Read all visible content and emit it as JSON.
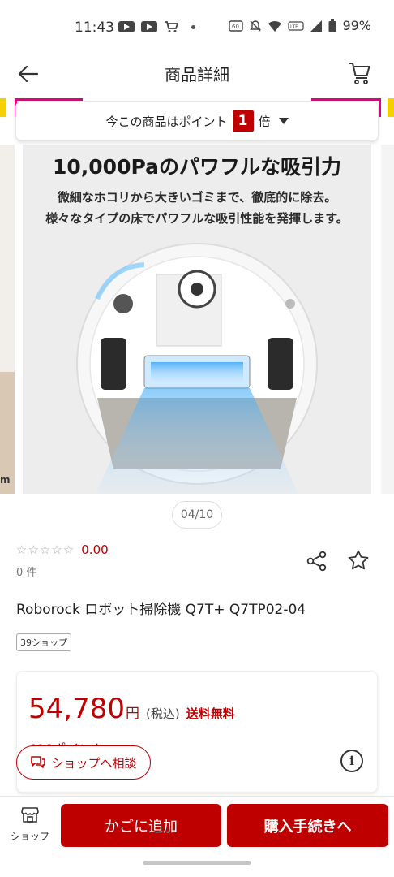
{
  "status_bar": {
    "time": "11:43",
    "battery": "99%",
    "icons": [
      "youtube-icon",
      "youtube-icon",
      "cart-notification-icon",
      "dot-icon",
      "data-saver-icon",
      "mute-icon",
      "wifi-icon",
      "volte-icon",
      "signal-icon",
      "battery-icon"
    ]
  },
  "header": {
    "title": "商品詳細",
    "back_icon": "back-arrow-icon",
    "cart_icon": "cart-icon"
  },
  "point_banner": {
    "text": "今この商品はポイント",
    "multiplier": "1",
    "suffix": "倍"
  },
  "carousel": {
    "headline": "10,000Paのパワフルな吸引力",
    "subline_1": "微細なホコリから大きいゴミまで、徹底的に除去。",
    "subline_2": "様々なタイプの床でパワフルな吸引性能を発揮します。",
    "page_indicator": "04/10",
    "prev_slide_fragment": "m"
  },
  "rating": {
    "value": "0.00",
    "stars_filled": 0,
    "stars_total": 5,
    "review_count": "0 件"
  },
  "product": {
    "title": "Roborock ロボット掃除機 Q7T+ Q7TP02-04",
    "shop_tag": "39ショップ"
  },
  "price": {
    "amount": "54,780",
    "currency": "円",
    "tax": "(税込)",
    "shipping": "送料無料",
    "points_earned": "498ポイント"
  },
  "consult_button": {
    "label": "ショップへ相談"
  },
  "bottom_bar": {
    "shop_label": "ショップ",
    "add_to_cart": "かごに追加",
    "checkout": "購入手続きへ"
  },
  "colors": {
    "accent": "#bf0000",
    "banner_yellow": "#f5d000",
    "banner_pink": "#e5007e"
  }
}
